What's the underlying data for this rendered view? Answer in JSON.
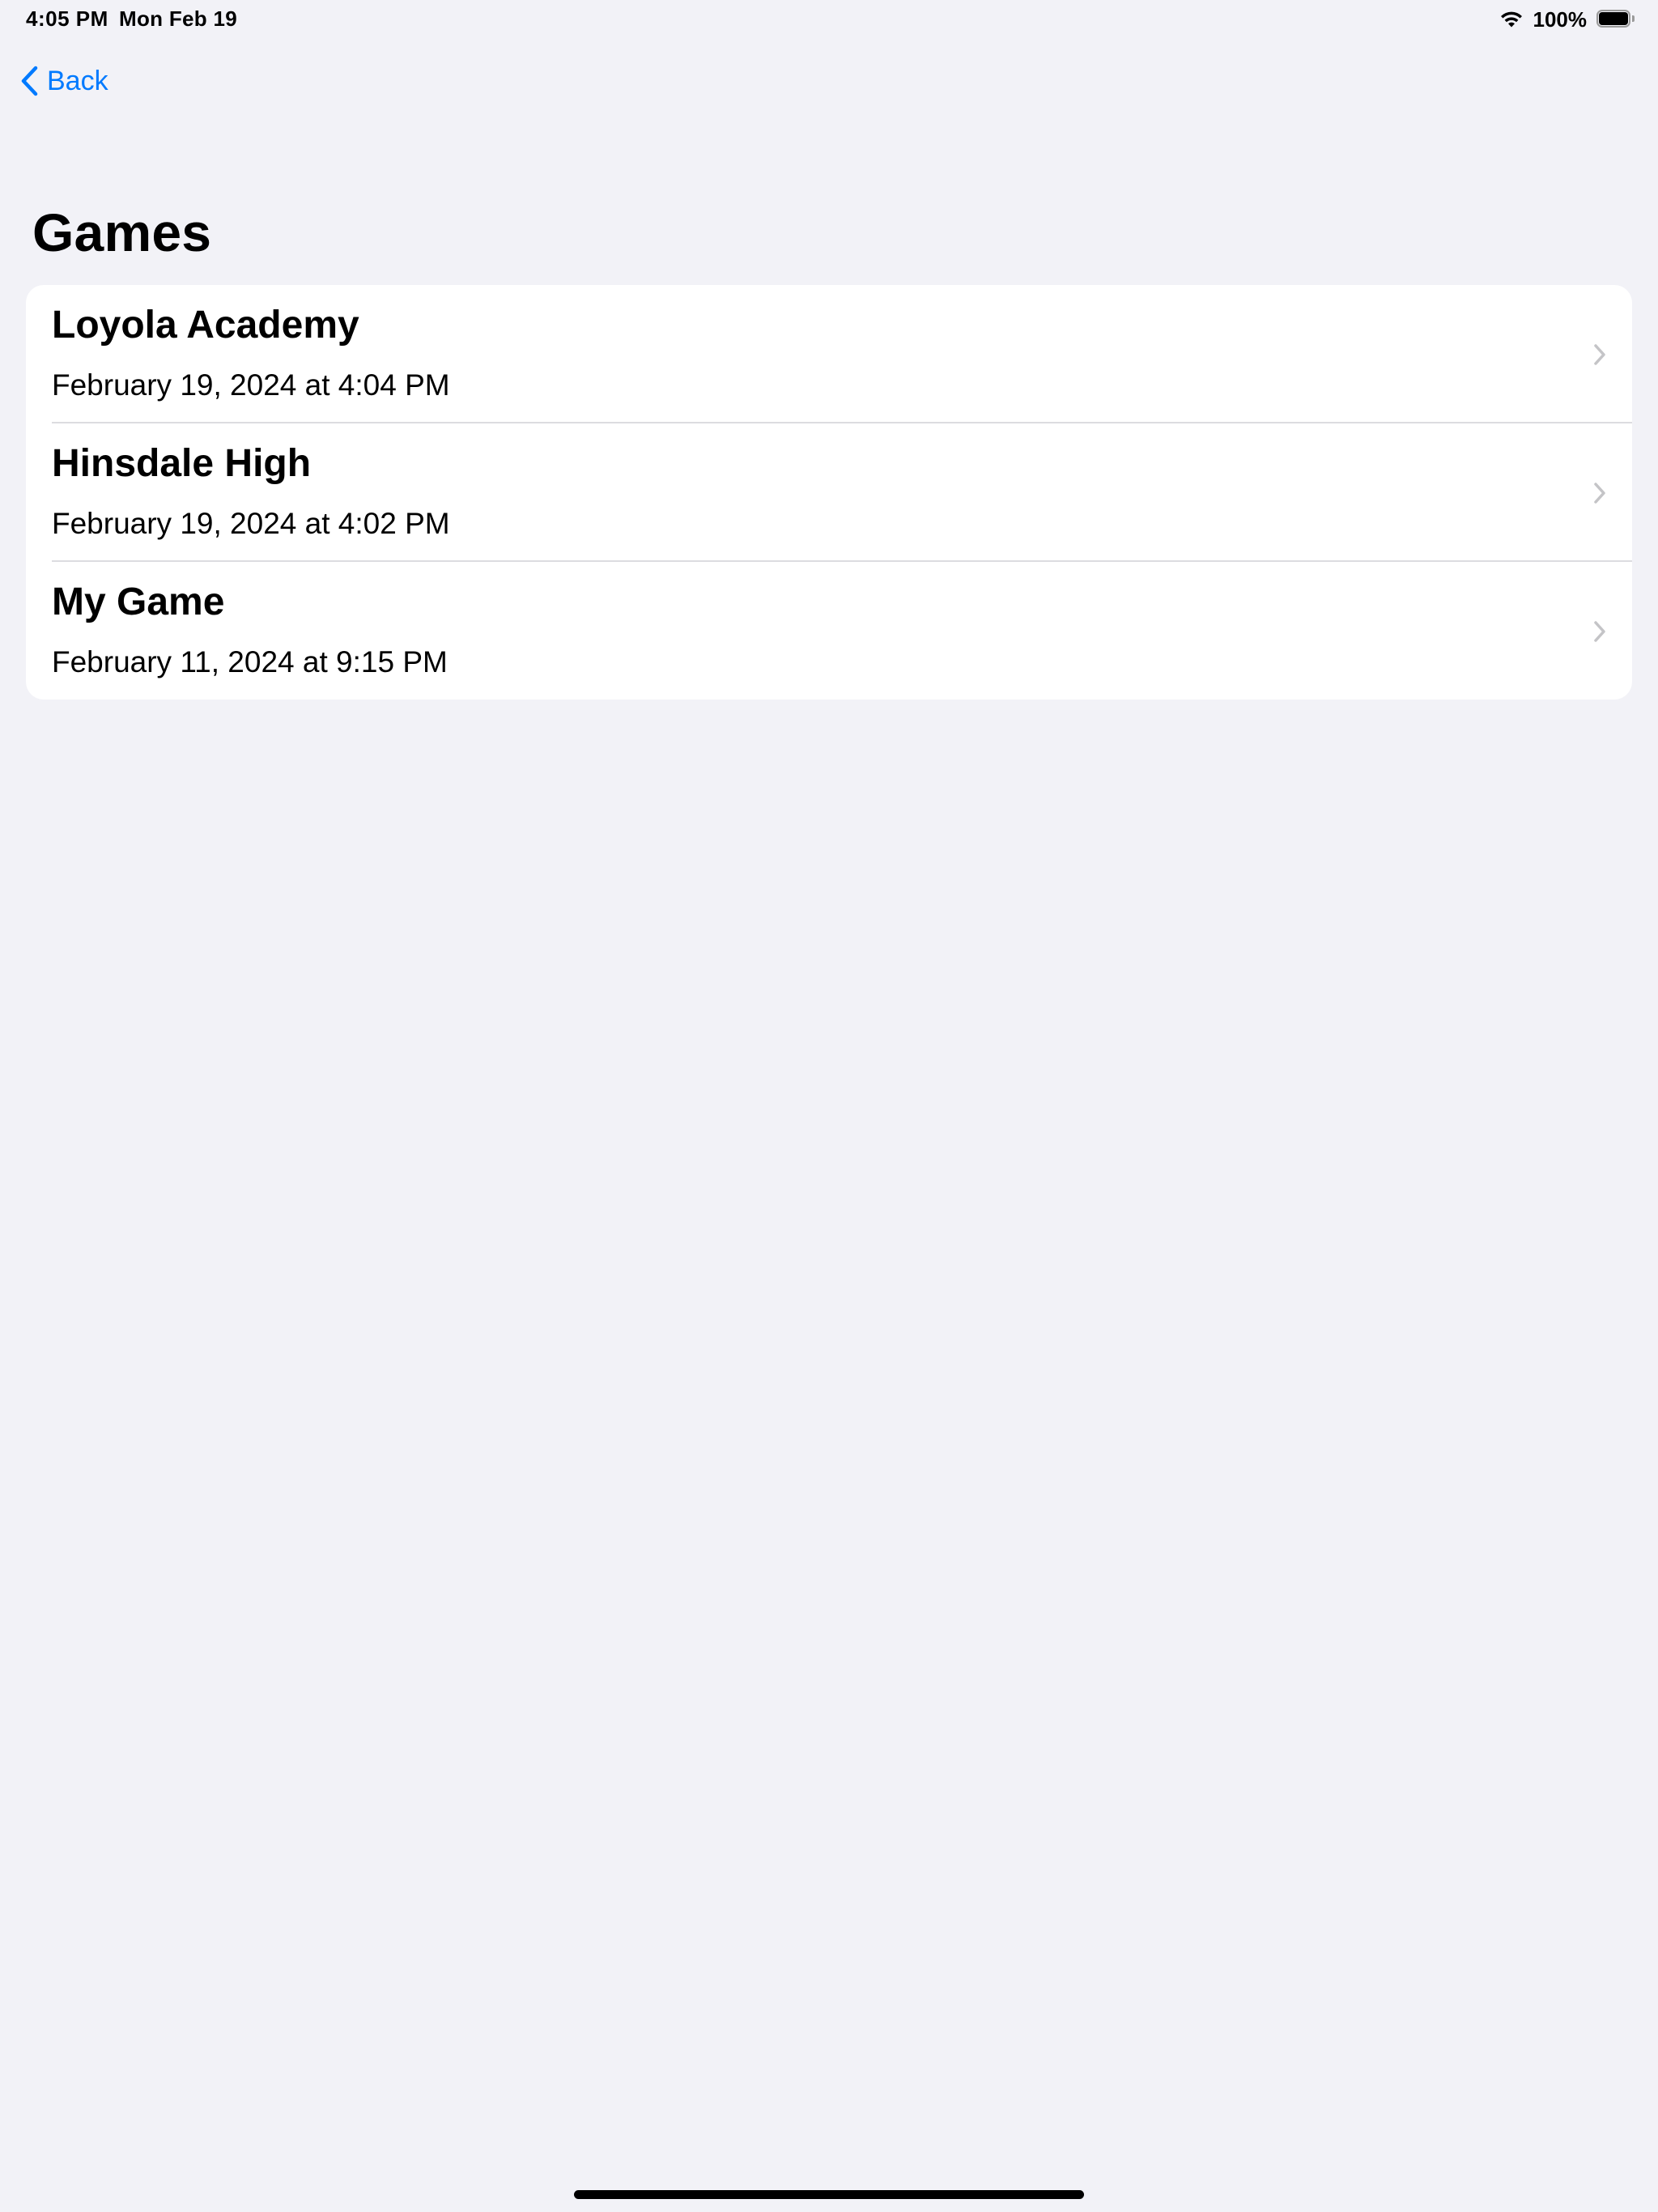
{
  "status_bar": {
    "time": "4:05 PM",
    "date": "Mon Feb 19",
    "battery_percent_text": "100%",
    "battery_level": 1.0,
    "icons": [
      "wifi-icon",
      "battery-icon"
    ]
  },
  "nav": {
    "back_label": "Back",
    "back_icon": "chevron-left-icon"
  },
  "page": {
    "title": "Games"
  },
  "games": [
    {
      "title": "Loyola Academy",
      "date": "February 19, 2024 at 4:04 PM"
    },
    {
      "title": "Hinsdale High",
      "date": "February 19, 2024 at 4:02 PM"
    },
    {
      "title": "My Game",
      "date": "February 11, 2024 at 9:15 PM"
    }
  ],
  "colors": {
    "accent": "#007aff",
    "background": "#f2f2f7",
    "card": "#ffffff",
    "chevron": "#c4c4c7"
  }
}
